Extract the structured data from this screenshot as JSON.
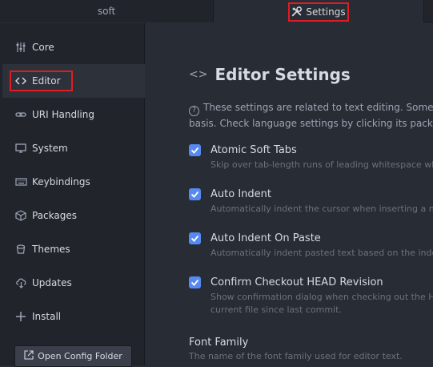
{
  "tabs": [
    {
      "label": "soft"
    },
    {
      "label": "Settings",
      "icon": "tools-icon"
    }
  ],
  "sidebar": {
    "items": [
      {
        "label": "Core",
        "icon": "sliders-icon"
      },
      {
        "label": "Editor",
        "icon": "code-icon",
        "active": true
      },
      {
        "label": "URI Handling",
        "icon": "link-icon"
      },
      {
        "label": "System",
        "icon": "monitor-icon"
      },
      {
        "label": "Keybindings",
        "icon": "keyboard-icon"
      },
      {
        "label": "Packages",
        "icon": "package-icon"
      },
      {
        "label": "Themes",
        "icon": "paintcan-icon"
      },
      {
        "label": "Updates",
        "icon": "cloud-download-icon"
      },
      {
        "label": "Install",
        "icon": "plus-icon"
      }
    ],
    "open_config_label": "Open Config Folder"
  },
  "main": {
    "title": "Editor Settings",
    "description_line1": "These settings are related to text editing. Some of t",
    "description_line2": "basis. Check language settings by clicking its package c",
    "settings": [
      {
        "title": "Atomic Soft Tabs",
        "checked": true,
        "desc": [
          "Skip over tab-length runs of leading whitespace wh"
        ]
      },
      {
        "title": "Auto Indent",
        "checked": true,
        "desc": [
          "Automatically indent the cursor when inserting a n"
        ]
      },
      {
        "title": "Auto Indent On Paste",
        "checked": true,
        "desc": [
          "Automatically indent pasted text based on the inde"
        ]
      },
      {
        "title": "Confirm Checkout HEAD Revision",
        "checked": true,
        "desc": [
          "Show confirmation dialog when checking out the H",
          "current file since last commit."
        ]
      }
    ],
    "font_family": {
      "title": "Font Family",
      "desc": "The name of the font family used for editor text."
    }
  },
  "colors": {
    "accent": "#568af2",
    "highlight_box": "#e21c24",
    "background": "#282c34",
    "sidebar": "#21252b"
  }
}
